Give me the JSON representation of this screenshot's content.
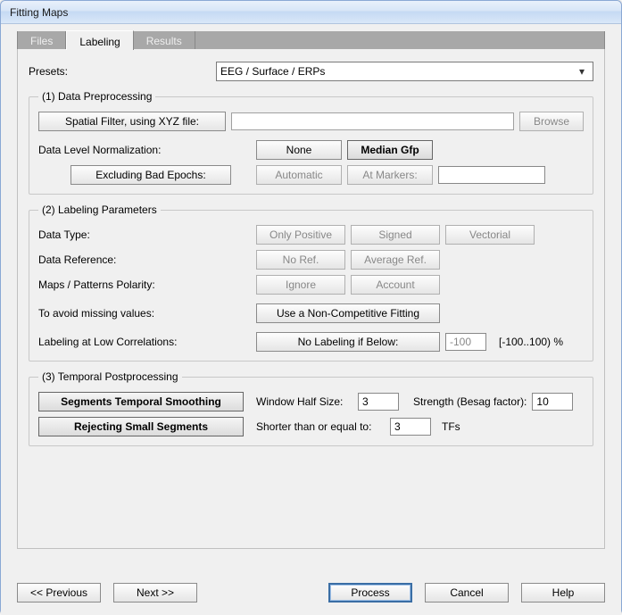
{
  "window": {
    "title": "Fitting Maps"
  },
  "tabs": {
    "files": "Files",
    "labeling": "Labeling",
    "results": "Results"
  },
  "presets": {
    "label": "Presets:",
    "value": "EEG / Surface / ERPs"
  },
  "section1": {
    "legend": "(1) Data  Preprocessing",
    "spatial_filter_btn": "Spatial Filter, using XYZ file:",
    "spatial_filter_path": "",
    "browse_btn": "Browse",
    "norm_label": "Data Level Normalization:",
    "norm_none": "None",
    "norm_median": "Median Gfp",
    "bad_epochs_btn": "Excluding Bad Epochs:",
    "bad_auto": "Automatic",
    "bad_markers": "At Markers:",
    "bad_markers_value": ""
  },
  "section2": {
    "legend": "(2) Labeling Parameters",
    "data_type_label": "Data Type:",
    "only_positive": "Only Positive",
    "signed": "Signed",
    "vectorial": "Vectorial",
    "data_ref_label": "Data Reference:",
    "no_ref": "No Ref.",
    "avg_ref": "Average Ref.",
    "polarity_label": "Maps / Patterns Polarity:",
    "ignore": "Ignore",
    "account": "Account",
    "avoid_label": "To avoid missing values:",
    "noncompetitive_btn": "Use a Non-Competitive Fitting",
    "lowcorr_label": "Labeling at Low Correlations:",
    "lowcorr_btn": "No Labeling if Below:",
    "lowcorr_value": "-100",
    "lowcorr_range": "[-100..100) %"
  },
  "section3": {
    "legend": "(3) Temporal  Postprocessing",
    "smoothing_btn": "Segments Temporal Smoothing",
    "window_label": "Window Half Size:",
    "window_value": "3",
    "strength_label": "Strength (Besag factor):",
    "strength_value": "10",
    "reject_btn": "Rejecting Small Segments",
    "shorter_label": "Shorter than or equal to:",
    "shorter_value": "3",
    "tfs": "TFs"
  },
  "footer": {
    "prev": "<<  Previous",
    "next": "Next  >>",
    "process": "Process",
    "cancel": "Cancel",
    "help": "Help"
  }
}
